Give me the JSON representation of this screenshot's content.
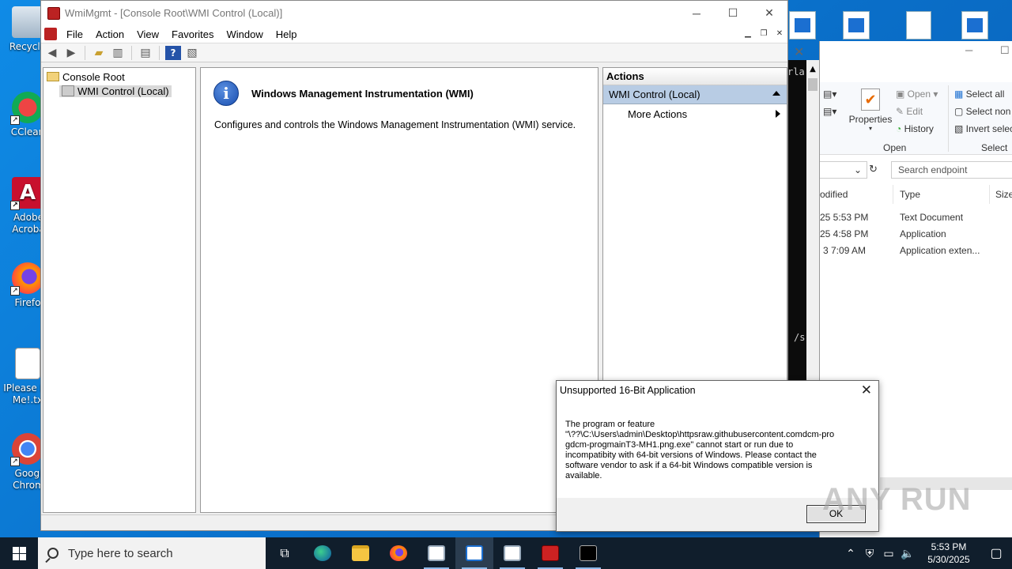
{
  "desktop": {
    "icons": [
      {
        "label": "Recycle"
      },
      {
        "label": "CClean"
      },
      {
        "label": "Adobe Acroba"
      },
      {
        "label": "Firefo"
      },
      {
        "label": "IPlease Re Me!.tx"
      },
      {
        "label": "Googl Chrom"
      }
    ]
  },
  "mmc": {
    "title": "WmiMgmt - [Console Root\\WMI Control (Local)]",
    "menu": [
      "File",
      "Action",
      "View",
      "Favorites",
      "Window",
      "Help"
    ],
    "tree": {
      "root": "Console Root",
      "child": "WMI Control (Local)"
    },
    "content": {
      "heading": "Windows Management Instrumentation (WMI)",
      "description": "Configures and controls the Windows Management Instrumentation (WMI) service."
    },
    "actions": {
      "header": "Actions",
      "group": "WMI Control (Local)",
      "more": "More Actions"
    }
  },
  "dialog": {
    "title": "Unsupported 16-Bit Application",
    "message_lines": [
      "The program or feature",
      "\"\\??\\C:\\Users\\admin\\Desktop\\httpsraw.githubusercontent.comdcm-pro",
      "gdcm-progmainT3-MH1.png.exe\" cannot start or run due to",
      "incompatibity with 64-bit versions of Windows. Please contact the",
      "software vendor to ask if a 64-bit Windows compatible version is",
      "available."
    ],
    "ok_label": "OK"
  },
  "explorer": {
    "ribbon": {
      "properties": "Properties",
      "open": "Open",
      "edit": "Edit",
      "history": "History",
      "open_group": "Open",
      "select_all": "Select all",
      "select_none": "Select non",
      "invert": "Invert selec",
      "select_group": "Select"
    },
    "search_placeholder": "Search endpoint",
    "columns": {
      "modified": "odified",
      "type": "Type",
      "size": "Size"
    },
    "rows": [
      {
        "date": "25 5:53 PM",
        "type": "Text Document"
      },
      {
        "date": "25 4:58 PM",
        "type": "Application"
      },
      {
        "date": "3 7:09 AM",
        "type": "Application exten..."
      }
    ]
  },
  "cmd": {
    "fragment1": "rla",
    "fragment2": "/s"
  },
  "watermark": "ANY RUN",
  "taskbar": {
    "search_placeholder": "Type here to search",
    "time": "5:53 PM",
    "date": "5/30/2025"
  },
  "colors": {
    "accent": "#0a78d4",
    "taskbar": "#101e2c",
    "selection": "#b8cce4"
  }
}
